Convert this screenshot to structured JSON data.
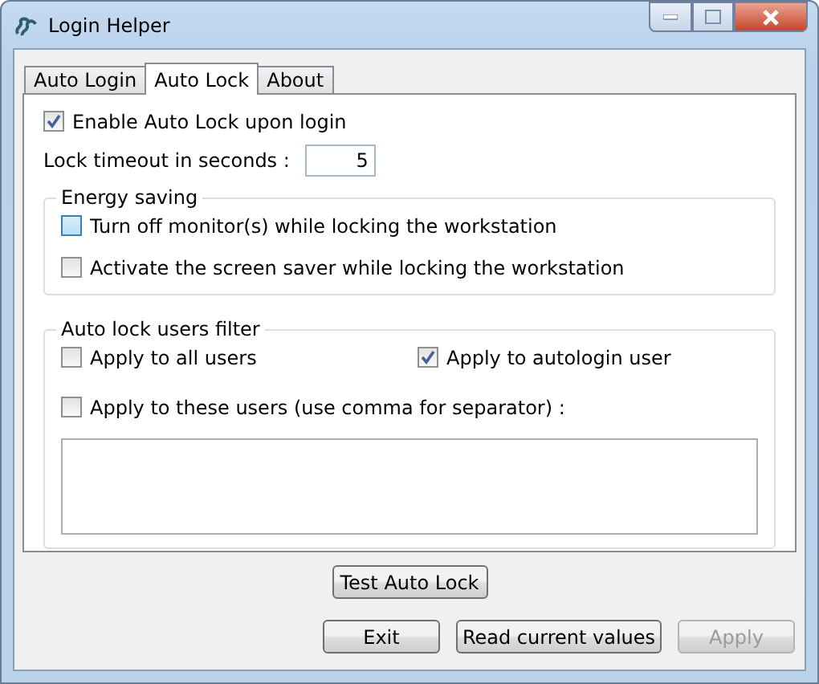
{
  "window": {
    "title": "Login Helper"
  },
  "tabs": [
    {
      "label": "Auto Login",
      "selected": false
    },
    {
      "label": "Auto Lock",
      "selected": true
    },
    {
      "label": "About",
      "selected": false
    }
  ],
  "enable_auto_lock": {
    "label": "Enable Auto Lock upon login",
    "checked": true
  },
  "lock_timeout": {
    "label": "Lock timeout in seconds :",
    "value": "5"
  },
  "energy_saving": {
    "title": "Energy saving",
    "options": [
      {
        "label": "Turn off monitor(s) while locking the workstation",
        "checked": false,
        "focused": true
      },
      {
        "label": "Activate the screen saver while locking the workstation",
        "checked": false,
        "focused": false
      }
    ]
  },
  "users_filter": {
    "title": "Auto lock users filter",
    "apply_all": {
      "label": "Apply to all users",
      "checked": false
    },
    "apply_autologin": {
      "label": "Apply to autologin user",
      "checked": true
    },
    "apply_these": {
      "label": "Apply to these users (use comma for separator) :",
      "checked": false
    }
  },
  "test_button": {
    "label": "Test Auto Lock"
  },
  "buttons": [
    {
      "label": "Exit",
      "disabled": false
    },
    {
      "label": "Read current values",
      "disabled": false
    },
    {
      "label": "Apply",
      "disabled": true
    }
  ]
}
